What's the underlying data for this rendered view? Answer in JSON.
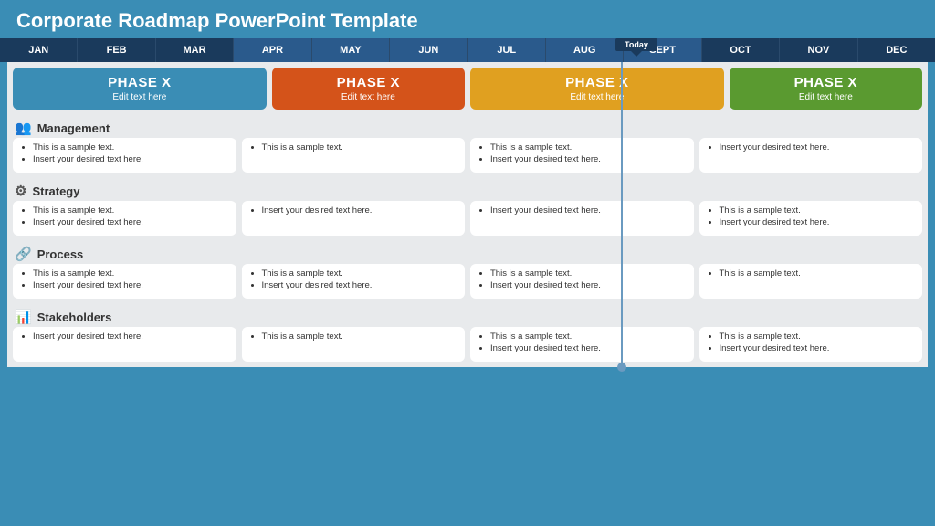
{
  "title": "Corporate Roadmap PowerPoint Template",
  "months": [
    "JAN",
    "FEB",
    "MAR",
    "APR",
    "MAY",
    "JUN",
    "JUL",
    "AUG",
    "SEPT",
    "OCT",
    "NOV",
    "DEC"
  ],
  "today_label": "Today",
  "today_month_index": 8,
  "phases": [
    {
      "label": "PHASE X",
      "sub": "Edit text here",
      "color": "blue",
      "span": 2
    },
    {
      "label": "PHASE X",
      "sub": "Edit text here",
      "color": "orange",
      "span": 1.5
    },
    {
      "label": "PHASE X",
      "sub": "Edit text here",
      "color": "yellow",
      "span": 2
    },
    {
      "label": "PHASE X",
      "sub": "Edit text here",
      "color": "green",
      "span": 1.5
    }
  ],
  "categories": [
    {
      "name": "Management",
      "icon": "👥",
      "cells": [
        [
          "This is a sample text.",
          "Insert your desired text here."
        ],
        [
          "This is a sample text."
        ],
        [
          "This is a sample text.",
          "Insert your desired text here."
        ],
        [
          "Insert your desired text here."
        ]
      ]
    },
    {
      "name": "Strategy",
      "icon": "⚙",
      "cells": [
        [
          "This is a sample text.",
          "Insert your desired text here."
        ],
        [
          "Insert your desired text here."
        ],
        [
          "Insert your desired text here."
        ],
        [
          "This is a sample text.",
          "Insert your desired text here."
        ]
      ]
    },
    {
      "name": "Process",
      "icon": "🔗",
      "cells": [
        [
          "This is a sample text.",
          "Insert your desired text here."
        ],
        [
          "This is a sample text.",
          "Insert your desired text here."
        ],
        [
          "This is a sample text.",
          "Insert your desired text here."
        ],
        [
          "This is a sample text."
        ]
      ]
    },
    {
      "name": "Stakeholders",
      "icon": "📊",
      "cells": [
        [
          "Insert your desired text here."
        ],
        [
          "This is a sample text."
        ],
        [
          "This is a sample text.",
          "Insert your desired text here."
        ],
        [
          "This is a sample text.",
          "Insert your desired text here."
        ]
      ]
    }
  ]
}
